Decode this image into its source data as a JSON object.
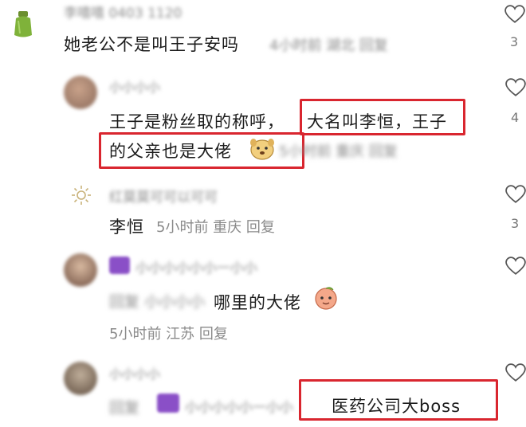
{
  "comments": [
    {
      "username": "",
      "text": "她老公不是叫王子安吗",
      "meta_blurred": "4小时前 湖北 回复",
      "likes": "3"
    },
    {
      "username": "",
      "text_line1_a": "王子是粉丝取的称呼，",
      "text_line1_b": "大名叫李恒，王子",
      "text_line2": "的父亲也是大佬",
      "likes": "4"
    },
    {
      "username": "",
      "text": "李恒",
      "meta": "5小时前 重庆 回复",
      "likes": "3"
    },
    {
      "username": "",
      "text": "哪里的大佬",
      "meta": "5小时前 江苏 回复",
      "likes": ""
    },
    {
      "username": "",
      "text": "医药公司大boss",
      "likes": ""
    }
  ],
  "colors": {
    "highlight": "#d9262f",
    "secondary_text": "#8a8a8a"
  }
}
